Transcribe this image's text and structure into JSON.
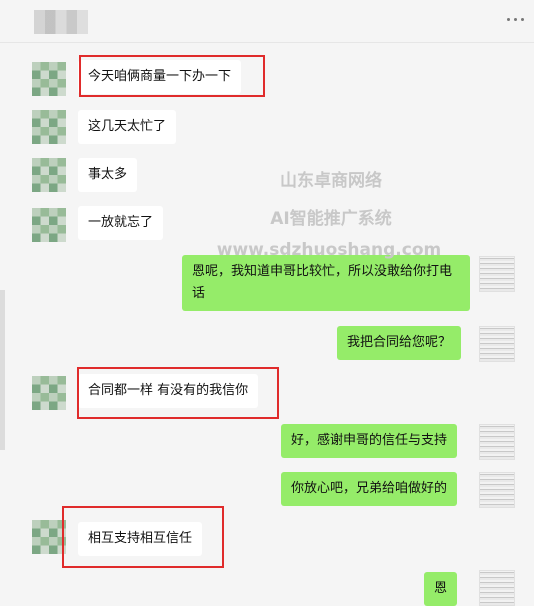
{
  "watermark": {
    "line1": "山东卓商网络",
    "line2": "AI智能推广系统",
    "line3": "www.sdzhuoshang.com"
  },
  "messages": [
    {
      "side": "left",
      "text": "今天咱俩商量一下办一下",
      "highlighted": true
    },
    {
      "side": "left",
      "text": "这几天太忙了",
      "highlighted": false
    },
    {
      "side": "left",
      "text": "事太多",
      "highlighted": false
    },
    {
      "side": "left",
      "text": "一放就忘了",
      "highlighted": false
    },
    {
      "side": "right",
      "text": "恩呢，我知道申哥比较忙，所以没敢给你打电话",
      "highlighted": false
    },
    {
      "side": "right",
      "text": "我把合同给您呢？",
      "highlighted": false
    },
    {
      "side": "left",
      "text": "合同都一样  有没有的我信你",
      "highlighted": true
    },
    {
      "side": "right",
      "text": "好，感谢申哥的信任与支持",
      "highlighted": false
    },
    {
      "side": "right",
      "text": "你放心吧，兄弟给咱做好的",
      "highlighted": false
    },
    {
      "side": "left",
      "text": "相互支持相互信任",
      "highlighted": true
    },
    {
      "side": "right",
      "text": "恩",
      "highlighted": false
    }
  ]
}
